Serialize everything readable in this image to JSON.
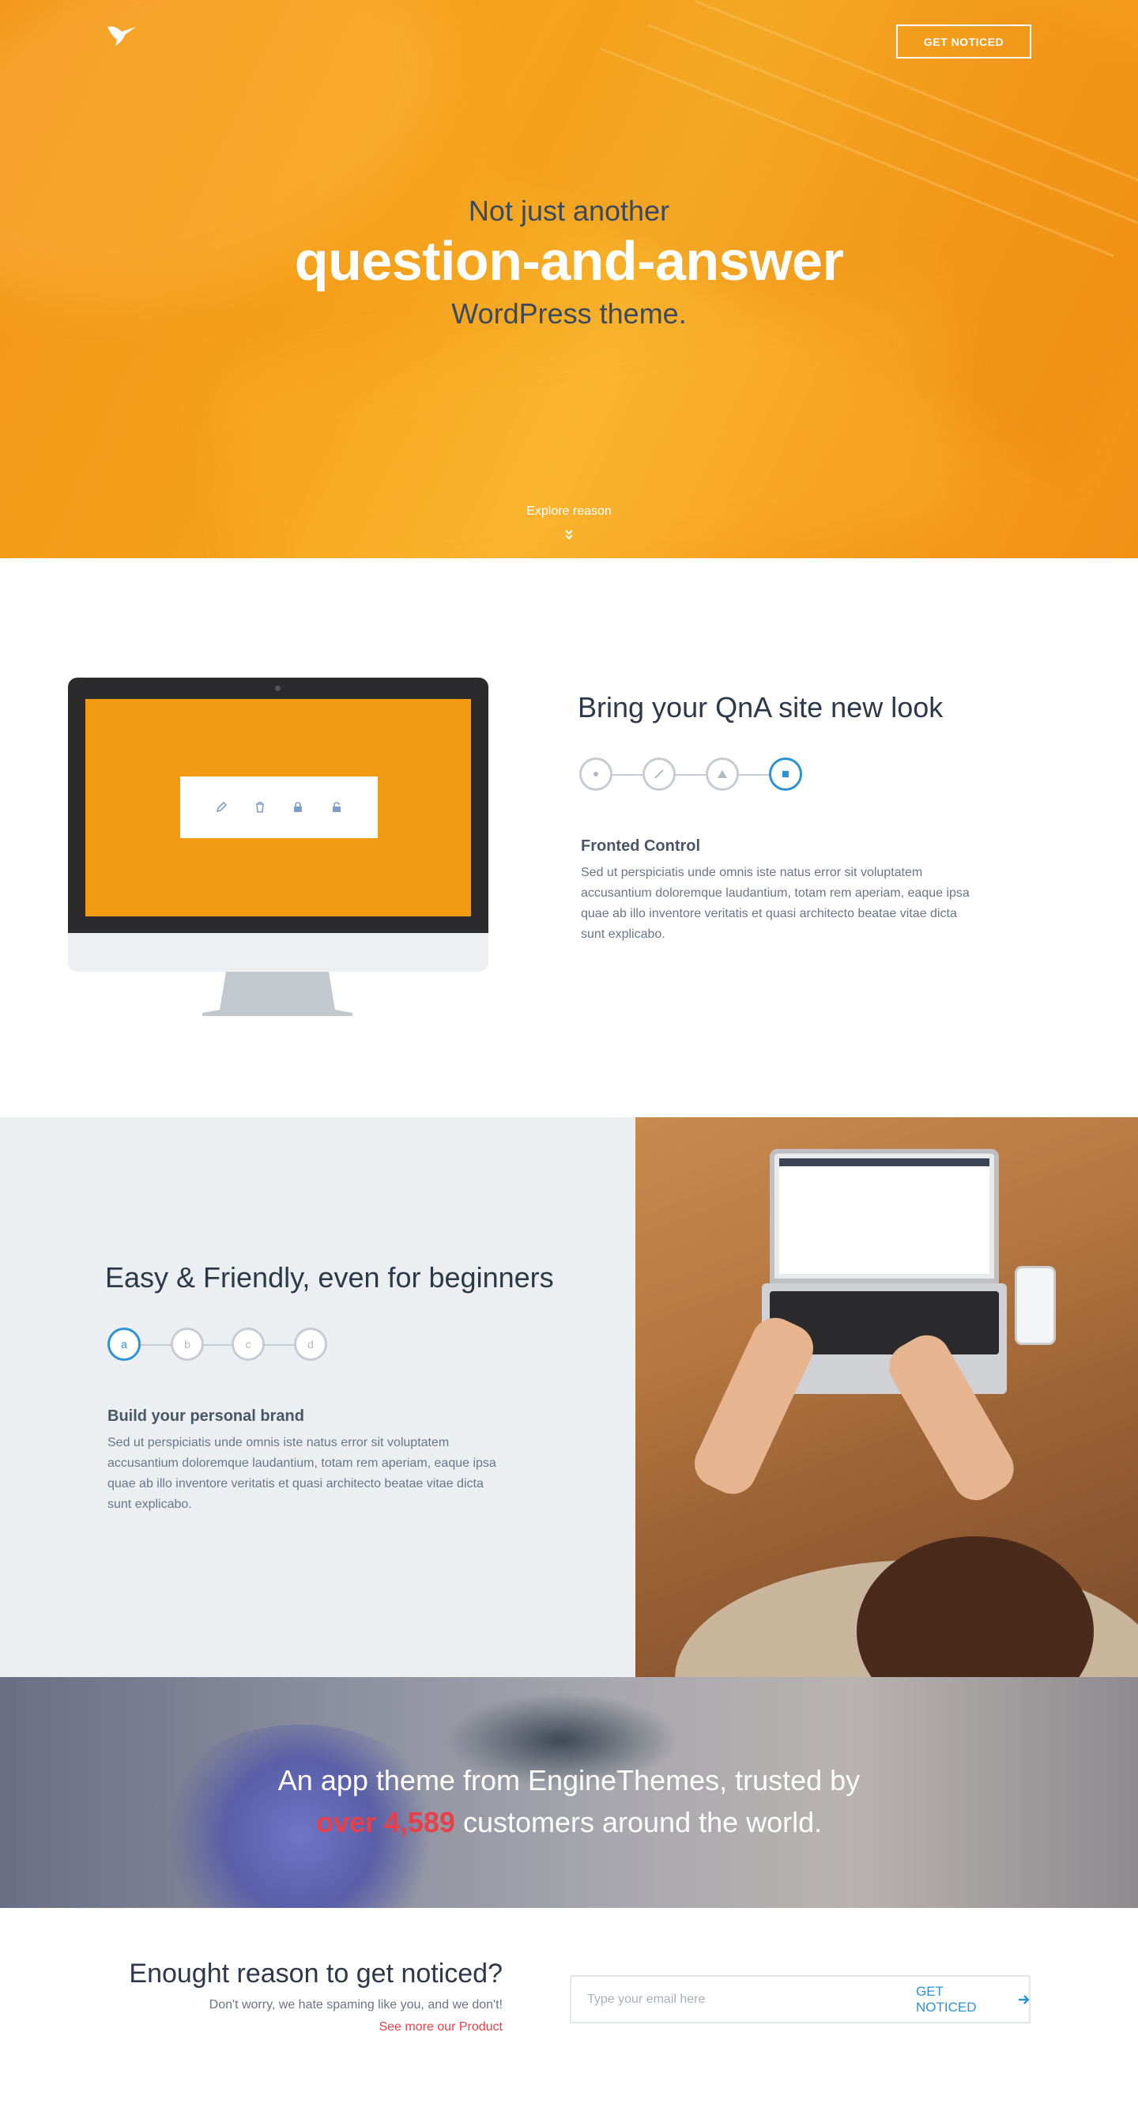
{
  "colors": {
    "accent_orange": "#f39c1a",
    "accent_blue": "#2c93d6",
    "accent_red": "#e8404a"
  },
  "header": {
    "logo_icon": "hummingbird-icon",
    "cta_label": "GET NOTICED"
  },
  "hero": {
    "line1": "Not just another",
    "line2": "question-and-answer",
    "line3": "WordPress theme.",
    "explore_label": "Explore reason",
    "explore_icon": "chevron-double-down-icon"
  },
  "qna": {
    "title": "Bring your QnA site new look",
    "steps": [
      {
        "icon": "dot-icon",
        "active": false
      },
      {
        "icon": "pencil-icon",
        "active": false
      },
      {
        "icon": "triangle-icon",
        "active": false
      },
      {
        "icon": "square-icon",
        "active": true
      }
    ],
    "subtitle": "Fronted Control",
    "body": "Sed ut perspiciatis unde omnis iste natus error sit voluptatem accusantium doloremque laudantium, totam rem aperiam, eaque ipsa quae ab illo inventore veritatis et quasi architecto beatae vitae dicta sunt explicabo.",
    "screen_tools": [
      "pencil-icon",
      "trash-icon",
      "lock-icon",
      "unlock-icon"
    ]
  },
  "friendly": {
    "title": "Easy & Friendly, even for beginners",
    "steps": [
      {
        "label": "a",
        "active": true
      },
      {
        "label": "b",
        "active": false
      },
      {
        "label": "c",
        "active": false
      },
      {
        "label": "d",
        "active": false
      }
    ],
    "subtitle": "Build your personal brand",
    "body": "Sed ut perspiciatis unde omnis iste natus error sit voluptatem accusantium doloremque laudantium, totam rem aperiam, eaque ipsa quae ab illo inventore veritatis et quasi architecto beatae vitae dicta sunt explicabo."
  },
  "trust": {
    "line1": "An app theme from EngineThemes, trusted by",
    "highlight": "over 4,589",
    "line2_rest": " customers around the world."
  },
  "signup": {
    "title": "Enought reason to get noticed?",
    "subtitle": "Don't worry, we hate spaming like you, and we don't!",
    "link": "See more our Product",
    "email_placeholder": "Type your email here",
    "button_label": "GET NOTICED",
    "button_icon": "arrow-right-icon"
  }
}
